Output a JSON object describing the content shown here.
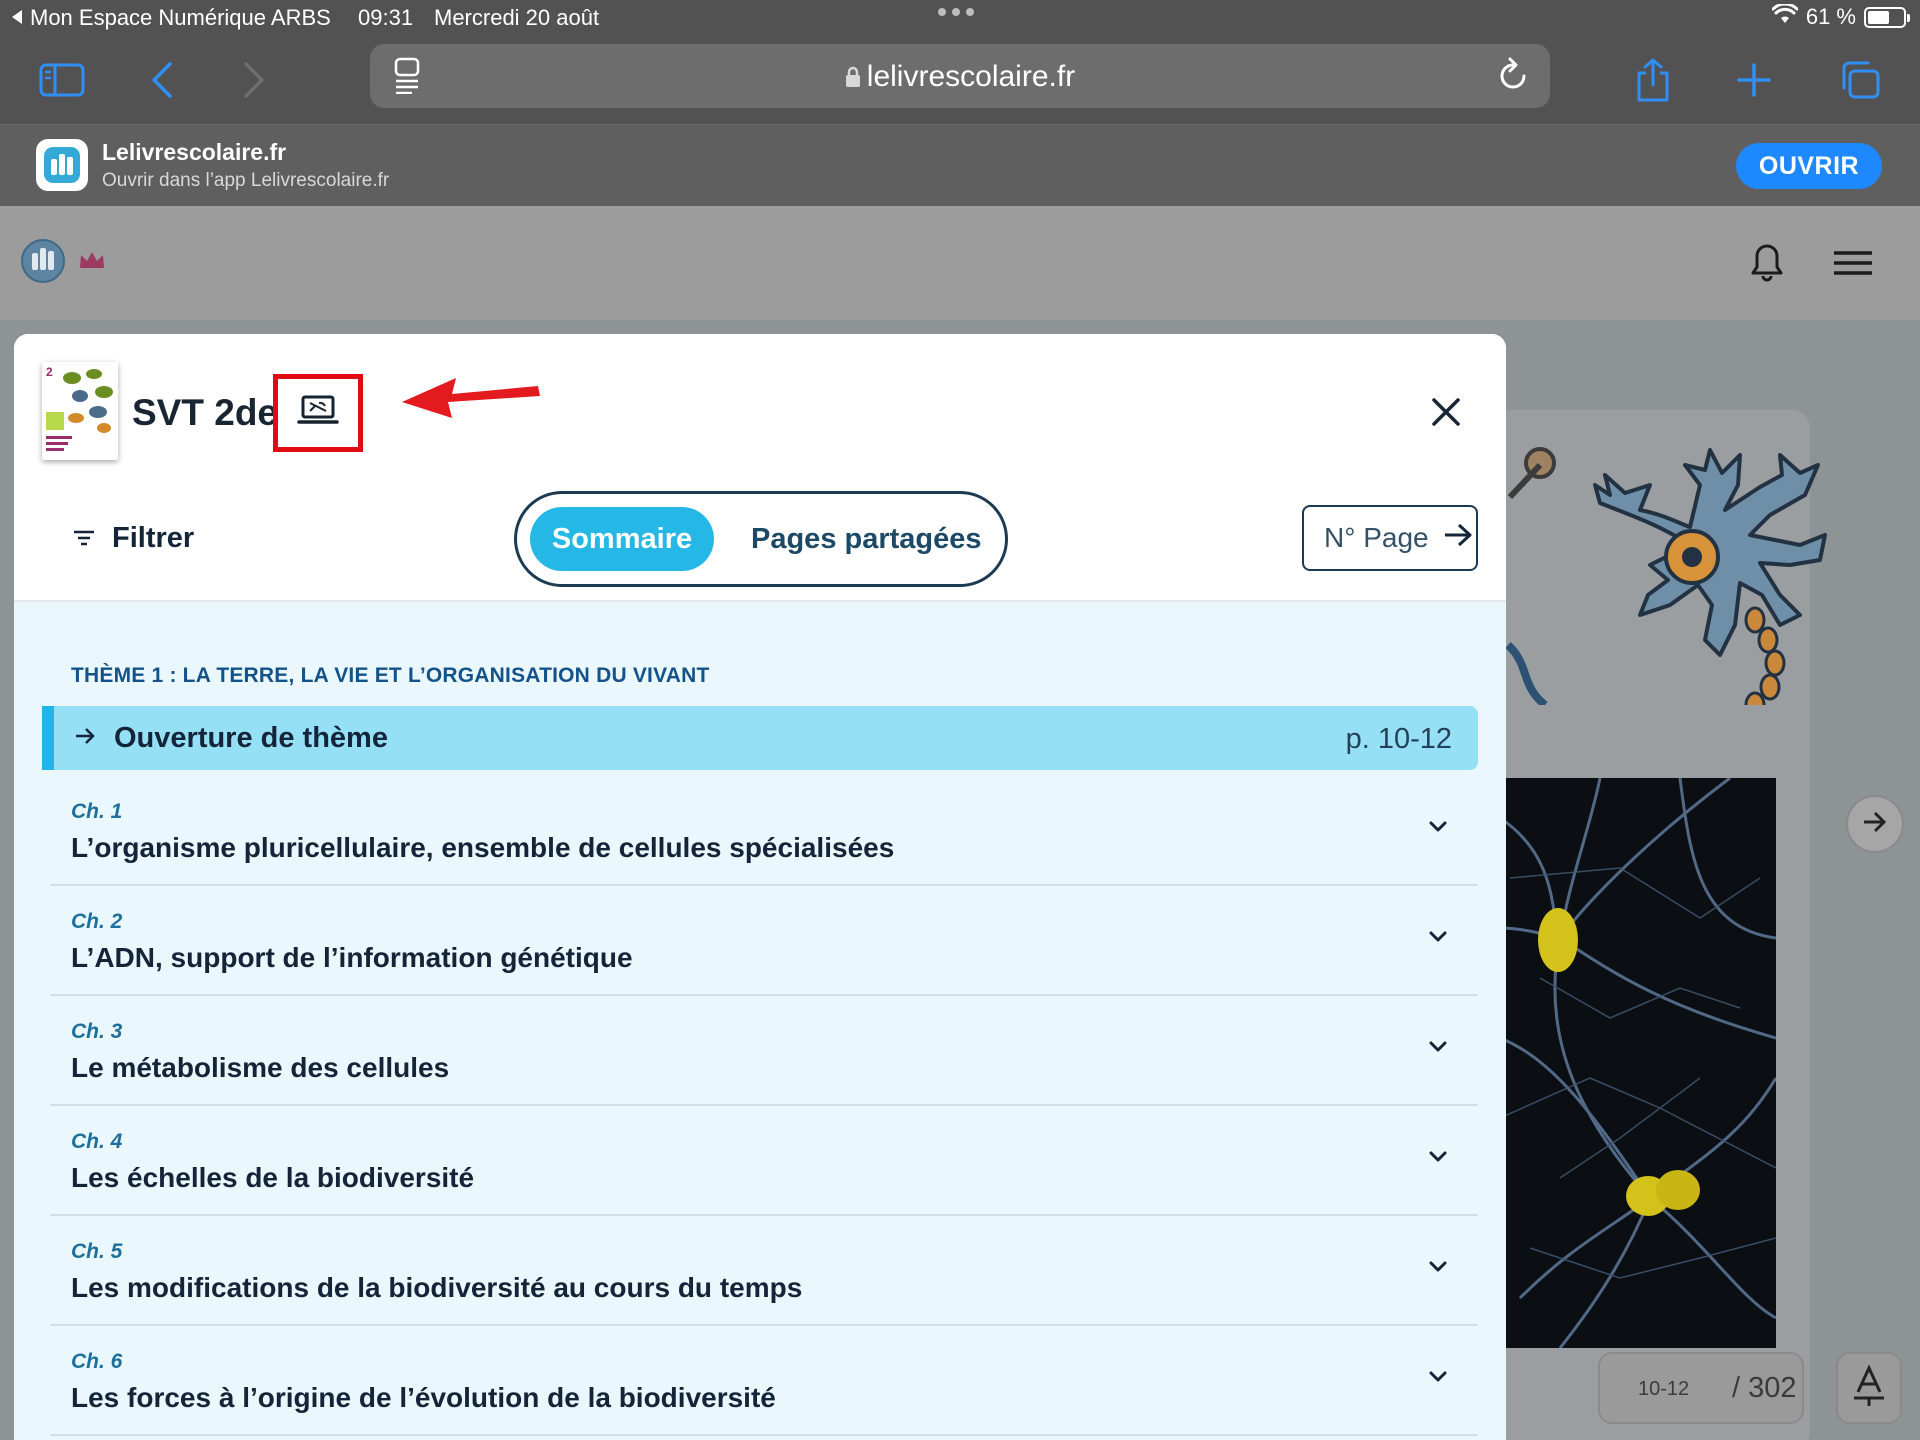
{
  "status_bar": {
    "back_app": "Mon Espace Numérique ARBS",
    "time": "09:31",
    "date": "Mercredi 20 août",
    "battery": "61 %",
    "battery_level": 0.61
  },
  "browser": {
    "url": "lelivrescolaire.fr",
    "icons": [
      "sidebar-icon",
      "back-icon",
      "forward-icon",
      "reader-icon",
      "lock-icon",
      "reload-icon",
      "share-icon",
      "new-tab-icon",
      "tabs-icon"
    ]
  },
  "app_banner": {
    "title": "Lelivrescolaire.fr",
    "subtitle": "Ouvrir dans l’app Lelivrescolaire.fr",
    "button": "OUVRIR"
  },
  "modal": {
    "book_title": "SVT 2de",
    "filter_label": "Filtrer",
    "tabs": [
      {
        "label": "Sommaire",
        "active": true
      },
      {
        "label": "Pages partagées",
        "active": false
      }
    ],
    "page_search_label": "N° Page",
    "theme": {
      "title": "THÈME 1 : LA TERRE, LA VIE ET L’ORGANISATION DU VIVANT",
      "opening": {
        "label": "Ouverture de thème",
        "pages": "p. 10-12"
      },
      "chapters": [
        {
          "num": "Ch. 1",
          "name": "L’organisme pluricellulaire, ensemble de cellules spécialisées"
        },
        {
          "num": "Ch. 2",
          "name": "L’ADN, support de l’information génétique"
        },
        {
          "num": "Ch. 3",
          "name": "Le métabolisme des cellules"
        },
        {
          "num": "Ch. 4",
          "name": "Les échelles de la biodiversité"
        },
        {
          "num": "Ch. 5",
          "name": "Les modifications de la biodiversité au cours du temps"
        },
        {
          "num": "Ch. 6",
          "name": "Les forces à l’origine de l’évolution de la biodiversité"
        }
      ]
    }
  },
  "background_page": {
    "current_page": "10-12",
    "total_pages": "/ 302"
  },
  "colors": {
    "accent": "#25b7e5",
    "highlight_row": "#96e0f6",
    "annotation_red": "#e00b14",
    "ios_blue": "#1e88ff"
  }
}
